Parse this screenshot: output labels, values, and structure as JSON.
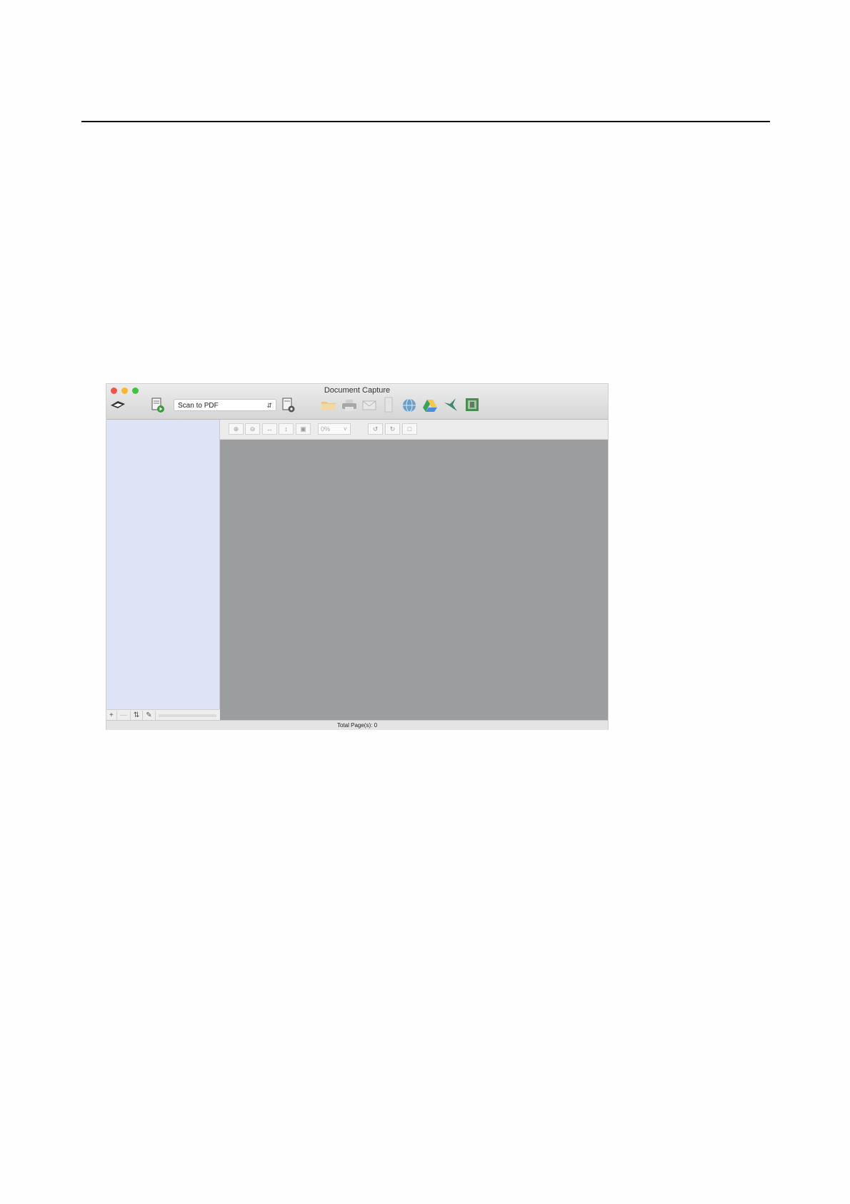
{
  "window": {
    "title": "Document Capture"
  },
  "toolbar": {
    "job_select": "Scan to PDF",
    "icons": [
      "scanner-logo-icon",
      "scan-start-icon",
      "job-settings-icon",
      "folder-icon",
      "printer-icon",
      "email-icon",
      "file-icon",
      "web-icon",
      "google-drive-icon",
      "hummingbird-icon",
      "evernote-icon"
    ]
  },
  "viewer_toolbar": {
    "zoom_value": "0%"
  },
  "sidebar_bottom": {
    "add": "+",
    "remove": "—",
    "sort": "⇅",
    "edit": "✎"
  },
  "status": {
    "total_pages": "Total Page(s): 0"
  }
}
